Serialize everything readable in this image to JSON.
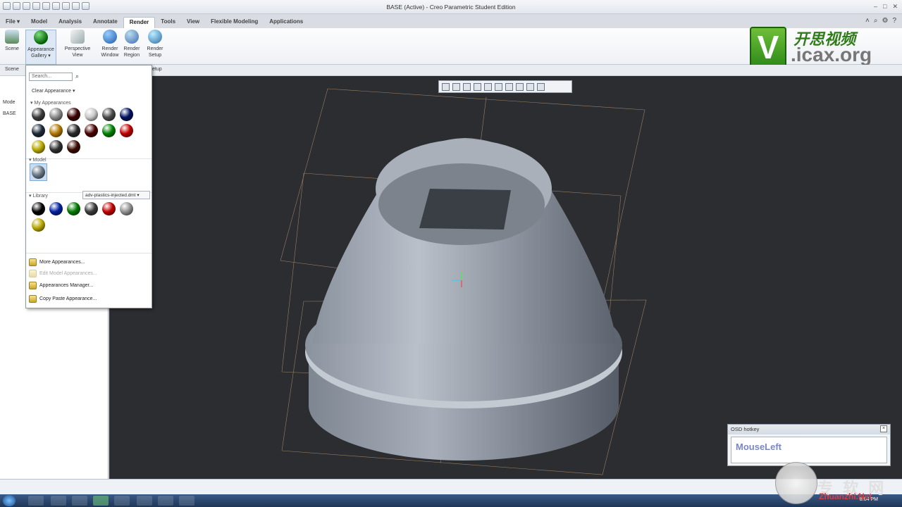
{
  "window": {
    "title": "BASE (Active) - Creo Parametric Student Edition"
  },
  "tabs": [
    {
      "label": "File ▾"
    },
    {
      "label": "Model"
    },
    {
      "label": "Analysis"
    },
    {
      "label": "Annotate"
    },
    {
      "label": "Render",
      "active": true
    },
    {
      "label": "Tools"
    },
    {
      "label": "View"
    },
    {
      "label": "Flexible Modeling"
    },
    {
      "label": "Applications"
    }
  ],
  "ribbon": {
    "scene": "Scene",
    "appearance_gallery": "Appearance\nGallery ▾",
    "perspective_view": "Perspective\nView",
    "render_window": "Render\nWindow",
    "render_region": "Render\nRegion",
    "render_setup": "Render\nSetup"
  },
  "subbar": {
    "scene": "Scene",
    "setup": "etup"
  },
  "logo": {
    "letter": "V",
    "cn": "开思视频",
    "url": ".icax.org"
  },
  "gallery": {
    "search_placeholder": "Search...",
    "clear": "Clear Appearance ▾",
    "my_appearances": "My Appearances",
    "model": "Model",
    "library": "Library",
    "library_value": "adv-plastics-injected.dmt",
    "my_colors": [
      "#3c3c3c",
      "#8a8a8a",
      "#3a0000",
      "#c8c8c8",
      "#4a4a4a",
      "#001060",
      "#1e2a3a",
      "#b07800",
      "#2a2a2a",
      "#4a0000",
      "#008000",
      "#c00000",
      "#b8a800",
      "#303030",
      "#3a0a00"
    ],
    "model_colors": [
      "#6a7888"
    ],
    "library_colors": [
      "#050505",
      "#0020a0",
      "#007a00",
      "#3a3a3a",
      "#c00000",
      "#909090",
      "#b8a800"
    ],
    "menu": [
      {
        "label": "More Appearances...",
        "disabled": false
      },
      {
        "label": "Edit Model Appearances...",
        "disabled": true
      },
      {
        "label": "Appearances Manager...",
        "disabled": false
      },
      {
        "label": "Copy Paste Appearance...",
        "disabled": false
      }
    ]
  },
  "tree": {
    "header": "Mode",
    "root": "BASE"
  },
  "osd": {
    "title": "OSD hotkey",
    "text": "MouseLeft"
  },
  "clock": "8:04 PM",
  "watermark": {
    "cn": "专 软 网",
    "en": "Zhuanzhi.Net"
  }
}
